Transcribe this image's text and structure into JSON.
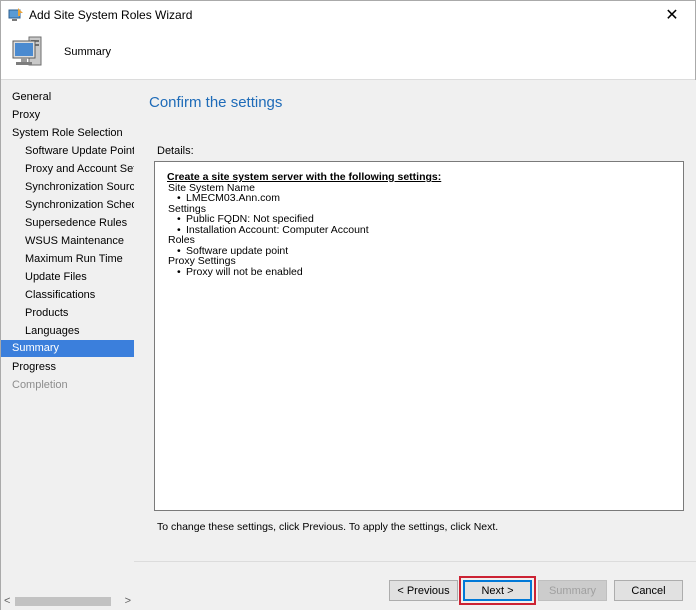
{
  "window": {
    "title": "Add Site System Roles Wizard",
    "close_glyph": "✕"
  },
  "header": {
    "page_name": "Summary"
  },
  "nav": {
    "items": [
      {
        "label": "General"
      },
      {
        "label": "Proxy"
      },
      {
        "label": "System Role Selection"
      },
      {
        "label": "Software Update Point"
      },
      {
        "label": "Proxy and Account Settin"
      },
      {
        "label": "Synchronization Source"
      },
      {
        "label": "Synchronization Schedule"
      },
      {
        "label": "Supersedence Rules"
      },
      {
        "label": "WSUS Maintenance"
      },
      {
        "label": "Maximum Run Time"
      },
      {
        "label": "Update Files"
      },
      {
        "label": "Classifications"
      },
      {
        "label": "Products"
      },
      {
        "label": "Languages"
      },
      {
        "label": "Summary"
      },
      {
        "label": "Progress"
      },
      {
        "label": "Completion"
      }
    ],
    "selected": "Summary",
    "scroll_left_glyph": "<",
    "scroll_right_glyph": ">"
  },
  "main": {
    "heading": "Confirm the settings",
    "details_label": "Details:",
    "details": {
      "headline": "Create a site system server with the following settings:",
      "site_system_name_label": "Site System Name",
      "site_system_name": "LMECM03.Ann.com",
      "settings_label": "Settings",
      "public_fqdn": "Public FQDN: Not specified",
      "installation_account": "Installation Account: Computer Account",
      "roles_label": "Roles",
      "role_1": "Software update point",
      "proxy_settings_label": "Proxy Settings",
      "proxy_1": "Proxy will not be enabled"
    },
    "hint": "To change these settings, click Previous. To apply the settings, click Next."
  },
  "buttons": {
    "previous": "< Previous",
    "next": "Next >",
    "summary": "Summary",
    "cancel": "Cancel"
  },
  "colors": {
    "accent": "#1e6bb8",
    "selection": "#3b7fdc",
    "focus_highlight": "#cc2233"
  }
}
